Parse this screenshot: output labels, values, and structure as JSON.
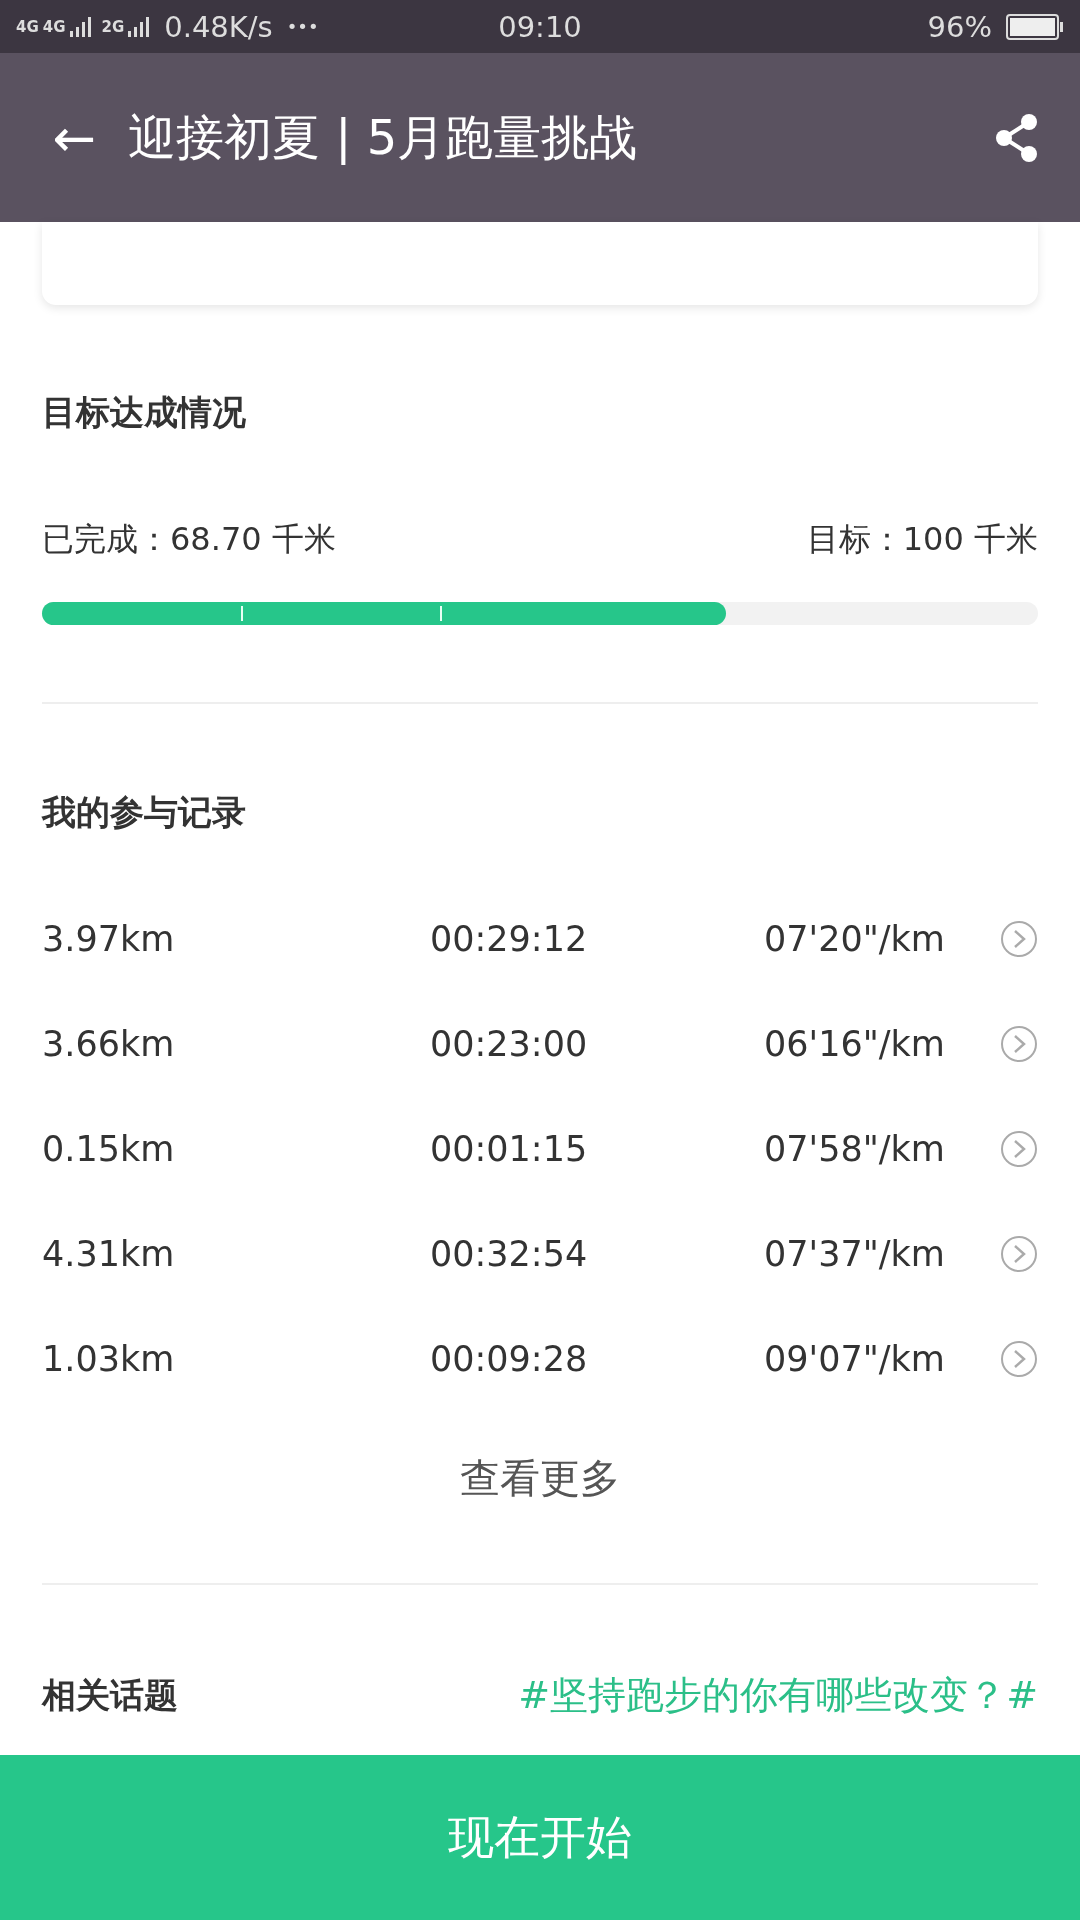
{
  "status_bar": {
    "network_labels": [
      "4G",
      "4G",
      "2G"
    ],
    "speed": "0.48K/s",
    "more": "•••",
    "time": "09:10",
    "battery": "96%"
  },
  "header": {
    "back": "←",
    "title": "迎接初夏 | 5月跑量挑战"
  },
  "goal": {
    "title": "目标达成情况",
    "completed": "已完成：68.70 千米",
    "target": "目标：100 千米",
    "level": 0.687
  },
  "records": {
    "title": "我的参与记录",
    "rows": [
      {
        "distance": "3.97km",
        "duration": "00:29:12",
        "pace": "07'20\"/km"
      },
      {
        "distance": "3.66km",
        "duration": "00:23:00",
        "pace": "06'16\"/km"
      },
      {
        "distance": "0.15km",
        "duration": "00:01:15",
        "pace": "07'58\"/km"
      },
      {
        "distance": "4.31km",
        "duration": "00:32:54",
        "pace": "07'37\"/km"
      },
      {
        "distance": "1.03km",
        "duration": "00:09:28",
        "pace": "09'07\"/km"
      }
    ],
    "more": "查看更多"
  },
  "topics": {
    "title": "相关话题",
    "link": "#坚持跑步的你有哪些改变？#"
  },
  "start_button": "现在开始"
}
